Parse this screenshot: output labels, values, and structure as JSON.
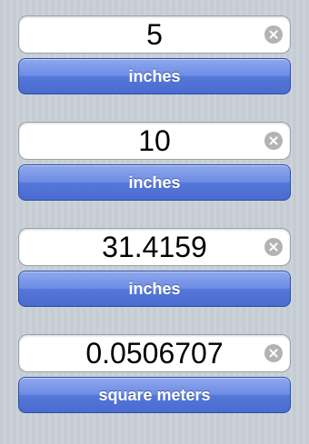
{
  "conversions": [
    {
      "value": "5",
      "unit": "inches"
    },
    {
      "value": "10",
      "unit": "inches"
    },
    {
      "value": "31.4159",
      "unit": "inches"
    },
    {
      "value": "0.0506707",
      "unit": "square meters"
    }
  ],
  "icons": {
    "clear": "clear-circle-x-icon"
  },
  "colors": {
    "button_blue": "#5577d9",
    "clear_icon_gray": "#b3b3b3",
    "background": "#c5ccd4"
  }
}
